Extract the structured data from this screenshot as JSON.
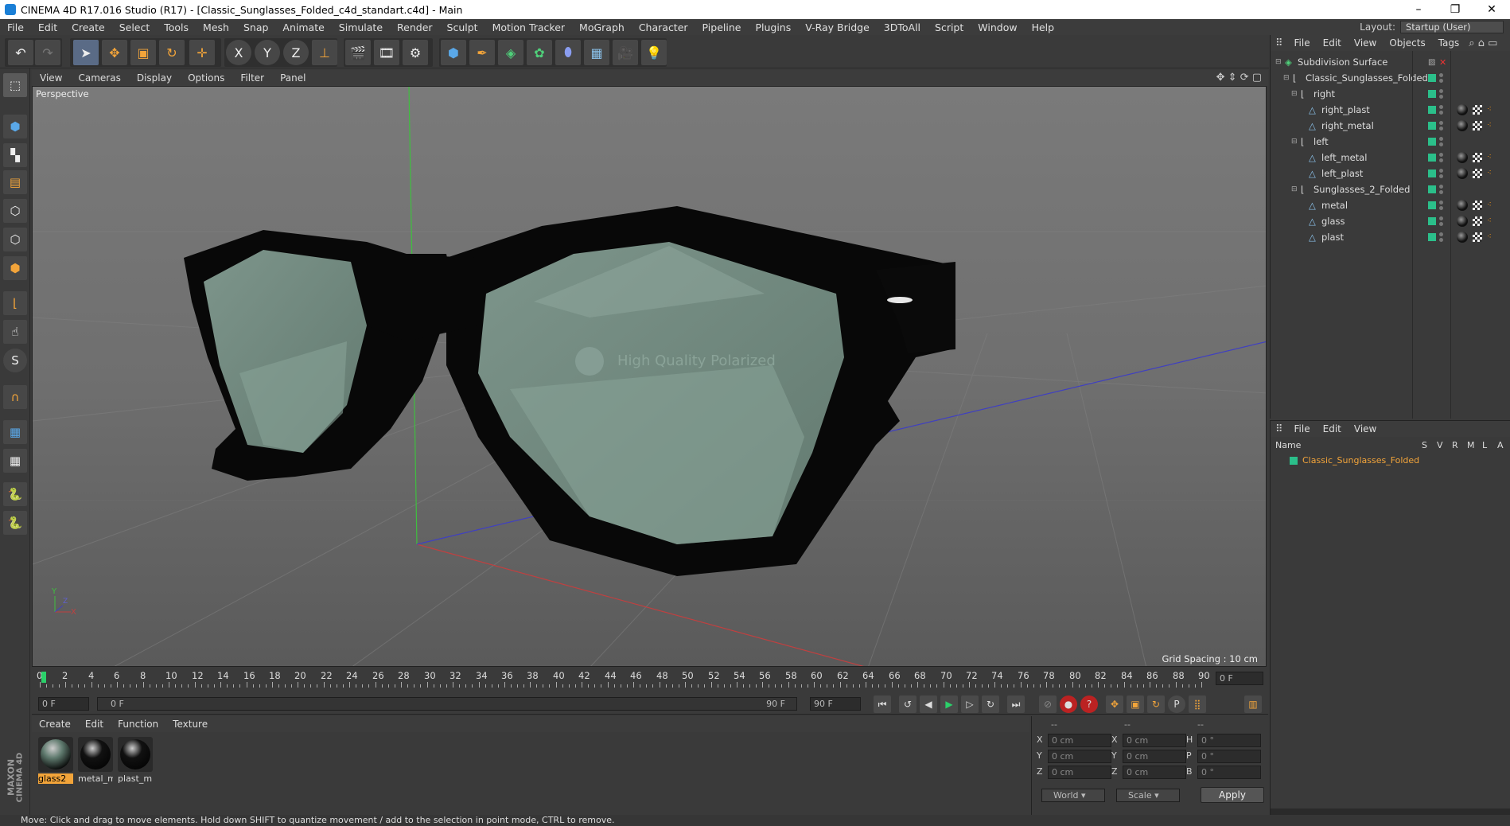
{
  "window": {
    "title": "CINEMA 4D R17.016 Studio (R17) - [Classic_Sunglasses_Folded_c4d_standart.c4d] - Main",
    "controls": [
      "–",
      "❐",
      "✕"
    ]
  },
  "menubar": {
    "items": [
      "File",
      "Edit",
      "Create",
      "Select",
      "Tools",
      "Mesh",
      "Snap",
      "Animate",
      "Simulate",
      "Render",
      "Sculpt",
      "Motion Tracker",
      "MoGraph",
      "Character",
      "Pipeline",
      "Plugins",
      "V-Ray Bridge",
      "3DToAll",
      "Script",
      "Window",
      "Help"
    ],
    "layout_label": "Layout:",
    "layout_value": "Startup (User)"
  },
  "toolbar": {
    "buttons": [
      "undo-icon",
      "redo-icon",
      "select-icon",
      "move-icon",
      "scale-icon",
      "rotate-icon",
      "live-select-icon",
      "x-axis-icon",
      "y-axis-icon",
      "z-axis-icon",
      "coord-system-icon",
      "render-view-icon",
      "render-picture-queue-icon",
      "render-settings-icon",
      "cube-icon",
      "pen-icon",
      "subdivision-icon",
      "cloner-icon",
      "deformer-icon",
      "floor-icon",
      "camera-icon",
      "light-icon"
    ],
    "axis_labels": [
      "X",
      "Y",
      "Z"
    ]
  },
  "left_toolbar": {
    "buttons": [
      "model-mode-icon",
      "object-mode-icon",
      "texture-mode-icon",
      "workplane-icon",
      "points-icon",
      "edges-icon",
      "polygons-icon",
      "axis-icon",
      "tweak-icon",
      "solo-icon",
      "magnet-icon",
      "snap-icon",
      "snap-settings-icon",
      "python-icon",
      "python-2-icon"
    ]
  },
  "viewport": {
    "menu": [
      "View",
      "Cameras",
      "Display",
      "Options",
      "Filter",
      "Panel"
    ],
    "label": "Perspective",
    "grid_spacing": "Grid Spacing : 10 cm",
    "axis_y": "Y",
    "axis_x": "X",
    "axis_z": "Z",
    "lens_text": "High Quality Polarized"
  },
  "timeline": {
    "ticks": [
      "0",
      "2",
      "4",
      "6",
      "8",
      "10",
      "12",
      "14",
      "16",
      "18",
      "20",
      "22",
      "24",
      "26",
      "28",
      "30",
      "32",
      "34",
      "36",
      "38",
      "40",
      "42",
      "44",
      "46",
      "48",
      "50",
      "52",
      "54",
      "56",
      "58",
      "60",
      "62",
      "64",
      "66",
      "68",
      "70",
      "72",
      "74",
      "76",
      "78",
      "80",
      "82",
      "84",
      "86",
      "88",
      "90"
    ],
    "current_frame": "0 F",
    "start_frame": "0 F",
    "range_start": "0 F",
    "range_end": "90 F",
    "end_frame": "90 F"
  },
  "materials": {
    "menu": [
      "Create",
      "Edit",
      "Function",
      "Texture"
    ],
    "items": [
      {
        "name": "glass2",
        "selected": true,
        "color": "#5f7a6e"
      },
      {
        "name": "metal_m",
        "selected": false,
        "color": "#111111"
      },
      {
        "name": "plast_m",
        "selected": false,
        "color": "#111111"
      }
    ],
    "brand_top": "MAXON",
    "brand_bottom": "CINEMA 4D"
  },
  "coordinates": {
    "header_left": "--",
    "header_mid": "--",
    "header_right": "--",
    "rows": [
      {
        "a": "X",
        "av": "0 cm",
        "b": "X",
        "bv": "0 cm",
        "c": "H",
        "cv": "0 °"
      },
      {
        "a": "Y",
        "av": "0 cm",
        "b": "Y",
        "bv": "0 cm",
        "c": "P",
        "cv": "0 °"
      },
      {
        "a": "Z",
        "av": "0 cm",
        "b": "Z",
        "bv": "0 cm",
        "c": "B",
        "cv": "0 °"
      }
    ],
    "world": "World",
    "scale": "Scale",
    "apply": "Apply"
  },
  "objects": {
    "menu": [
      "File",
      "Edit",
      "View",
      "Objects",
      "Tags"
    ],
    "rows": [
      {
        "name": "Subdivision Surface",
        "depth": 0,
        "type": "subdivision"
      },
      {
        "name": "Classic_Sunglasses_Folded",
        "depth": 1,
        "type": "null"
      },
      {
        "name": "right",
        "depth": 2,
        "type": "null"
      },
      {
        "name": "right_plast",
        "depth": 3,
        "type": "poly"
      },
      {
        "name": "right_metal",
        "depth": 3,
        "type": "poly"
      },
      {
        "name": "left",
        "depth": 2,
        "type": "null"
      },
      {
        "name": "left_metal",
        "depth": 3,
        "type": "poly"
      },
      {
        "name": "left_plast",
        "depth": 3,
        "type": "poly"
      },
      {
        "name": "Sunglasses_2_Folded",
        "depth": 2,
        "type": "null"
      },
      {
        "name": "metal",
        "depth": 3,
        "type": "poly"
      },
      {
        "name": "glass",
        "depth": 3,
        "type": "poly"
      },
      {
        "name": "plast",
        "depth": 3,
        "type": "poly"
      }
    ]
  },
  "attributes": {
    "menu": [
      "File",
      "Edit",
      "View"
    ],
    "columns": [
      "Name",
      "S",
      "V",
      "R",
      "M",
      "L",
      "A"
    ],
    "layer_name": "Classic_Sunglasses_Folded"
  },
  "status": {
    "text": "Move: Click and drag to move elements. Hold down SHIFT to quantize movement / add to the selection in point mode, CTRL to remove."
  }
}
